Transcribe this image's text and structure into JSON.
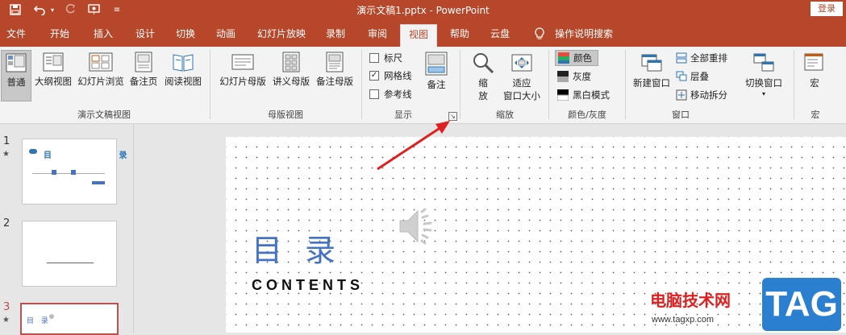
{
  "window": {
    "title": "演示文稿1.pptx  -  PowerPoint",
    "login_label": "登录",
    "accent": "#b7472a"
  },
  "quick_access": {
    "save_icon": "save-icon",
    "undo_icon": "undo-icon",
    "redo_icon": "redo-icon",
    "present_icon": "present-from-start-icon",
    "customize_icon": "customize-toolbar-icon"
  },
  "tabs": [
    {
      "label": "文件"
    },
    {
      "label": "开始"
    },
    {
      "label": "插入"
    },
    {
      "label": "设计"
    },
    {
      "label": "切换"
    },
    {
      "label": "动画"
    },
    {
      "label": "幻灯片放映"
    },
    {
      "label": "录制"
    },
    {
      "label": "审阅"
    },
    {
      "label": "视图",
      "active": true
    },
    {
      "label": "帮助"
    },
    {
      "label": "云盘"
    },
    {
      "label": "操作说明搜索"
    }
  ],
  "ribbon": {
    "groups": {
      "presentation_views": "演示文稿视图",
      "master_views": "母版视图",
      "show": "显示",
      "zoom": "缩放",
      "color_grayscale": "颜色/灰度",
      "window": "窗口",
      "macros": "宏"
    },
    "presentation_views": {
      "normal": "普通",
      "outline": "大纲视图",
      "slide_sorter": "幻灯片浏览",
      "notes_page": "备注页",
      "reading": "阅读视图"
    },
    "master_views": {
      "slide_master": "幻灯片母版",
      "handout_master": "讲义母版",
      "notes_master": "备注母版"
    },
    "show": {
      "ruler": "标尺",
      "ruler_checked": false,
      "gridlines": "网格线",
      "gridlines_checked": true,
      "guides": "参考线",
      "guides_checked": false,
      "notes": "备注"
    },
    "zoom": {
      "zoom_line1": "缩",
      "zoom_line2": "放",
      "fit_line1": "适应",
      "fit_line2": "窗口大小"
    },
    "color": {
      "color": "颜色",
      "grayscale": "灰度",
      "black_white": "黑白模式"
    },
    "window": {
      "new_window": "新建窗口",
      "arrange_all": "全部重排",
      "cascade": "层叠",
      "move_split": "移动拆分",
      "switch_windows": "切换窗口"
    },
    "macros": {
      "macros": "宏"
    }
  },
  "thumbnails": [
    {
      "number": "1",
      "star": "★",
      "title_text": "目  录"
    },
    {
      "number": "2",
      "star": ""
    },
    {
      "number": "3",
      "star": "★",
      "title_text": "目 录",
      "selected": true
    }
  ],
  "slide": {
    "title": "目录",
    "subtitle": "CONTENTS",
    "audio_icon": "speaker-icon"
  },
  "watermark": {
    "site_name": "电脑技术网",
    "url": "www.tagxp.com",
    "tag": "TAG"
  }
}
